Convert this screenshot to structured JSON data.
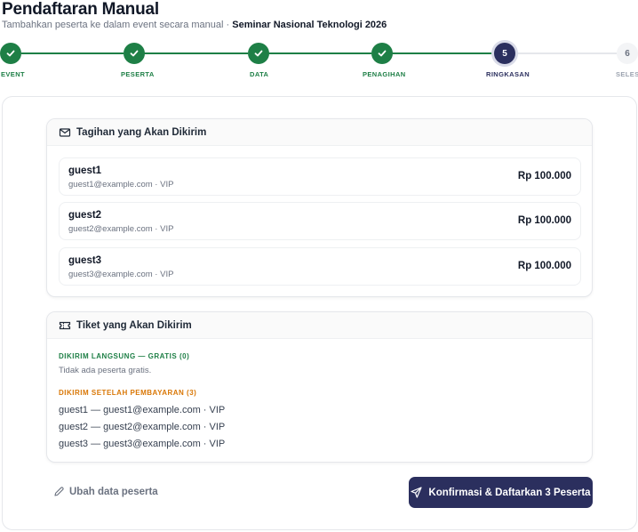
{
  "header": {
    "title": "Pendaftaran Manual",
    "subtitle": "Tambahkan peserta ke dalam event secara manual ·",
    "event_name": "Seminar Nasional Teknologi 2026"
  },
  "stepper": {
    "steps": [
      {
        "label": "EVENT",
        "state": "done",
        "number": ""
      },
      {
        "label": "PESERTA",
        "state": "done",
        "number": ""
      },
      {
        "label": "DATA",
        "state": "done",
        "number": ""
      },
      {
        "label": "PENAGIHAN",
        "state": "done",
        "number": ""
      },
      {
        "label": "RINGKASAN",
        "state": "active",
        "number": "5"
      },
      {
        "label": "SELESA",
        "state": "pending",
        "number": "6"
      }
    ]
  },
  "billing": {
    "title": "Tagihan yang Akan Dikirim",
    "icon": "mail-icon",
    "rows": [
      {
        "name": "guest1",
        "meta": "guest1@example.com · VIP",
        "amount": "Rp 100.000"
      },
      {
        "name": "guest2",
        "meta": "guest2@example.com · VIP",
        "amount": "Rp 100.000"
      },
      {
        "name": "guest3",
        "meta": "guest3@example.com · VIP",
        "amount": "Rp 100.000"
      }
    ]
  },
  "tickets": {
    "title": "Tiket yang Akan Dikirim",
    "icon": "ticket-icon",
    "free_label": "DIKIRIM LANGSUNG — GRATIS (0)",
    "free_empty": "Tidak ada peserta gratis.",
    "paid_label": "DIKIRIM SETELAH PEMBAYARAN (3)",
    "paid_items": [
      "guest1 — guest1@example.com · VIP",
      "guest2 — guest2@example.com · VIP",
      "guest3 — guest3@example.com · VIP"
    ]
  },
  "actions": {
    "edit_label": "Ubah data peserta",
    "confirm_label": "Konfirmasi & Daftarkan 3 Peserta"
  },
  "colors": {
    "success": "#1e7f46",
    "primary": "#2b2f5e",
    "warning": "#d97706"
  }
}
